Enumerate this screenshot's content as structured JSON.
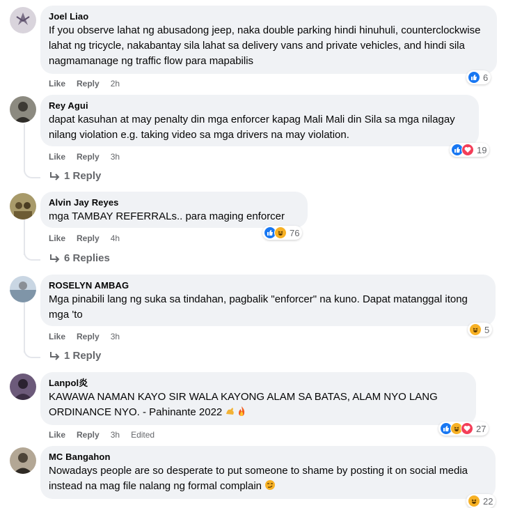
{
  "comments": [
    {
      "author": "Joel Liao",
      "text": "If you observe lahat ng abusadong jeep, naka double parking hindi hinuhuli, counterclockwise lahat ng tricycle, nakabantay sila lahat sa delivery vans and private vehicles, and hindi sila nagmamanage ng traffic flow para mapabilis",
      "like_label": "Like",
      "reply_label": "Reply",
      "time": "2h",
      "reaction_count": "6",
      "reactions": [
        "like"
      ]
    },
    {
      "author": "Rey Agui",
      "text": "dapat kasuhan at may penalty din mga enforcer kapag Mali Mali din Sila sa mga nilagay nilang violation e.g. taking video sa mga drivers na may violation.",
      "like_label": "Like",
      "reply_label": "Reply",
      "time": "3h",
      "reaction_count": "19",
      "reactions": [
        "like",
        "love"
      ],
      "replies_label": "1 Reply"
    },
    {
      "author": "Alvin Jay Reyes",
      "text": "mga TAMBAY REFERRALs.. para maging enforcer",
      "like_label": "Like",
      "reply_label": "Reply",
      "time": "4h",
      "reaction_count": "76",
      "reactions": [
        "like",
        "haha"
      ],
      "replies_label": "6 Replies"
    },
    {
      "author": "ROSELYN AMBAG",
      "text": "Mga pinabili lang ng suka sa tindahan, pagbalik \"enforcer\" na kuno. Dapat matanggal itong mga 'to",
      "like_label": "Like",
      "reply_label": "Reply",
      "time": "3h",
      "reaction_count": "5",
      "reactions": [
        "haha"
      ],
      "replies_label": "1 Reply"
    },
    {
      "author": "Lanpol炎",
      "text": "KAWAWA NAMAN KAYO SIR WALA KAYONG ALAM SA BATAS, ALAM NYO LANG ORDINANCE NYO. - Pahinante 2022",
      "like_label": "Like",
      "reply_label": "Reply",
      "time": "3h",
      "edited_label": "Edited",
      "reaction_count": "27",
      "reactions": [
        "like",
        "haha",
        "love"
      ]
    },
    {
      "author": "MC Bangahon",
      "text": "Nowadays people are so desperate to put someone to shame by posting it on social media instead na mag file nalang ng formal complain",
      "reaction_count": "22",
      "reactions": [
        "haha"
      ]
    }
  ],
  "colors": {
    "bubble": "#f0f2f5",
    "meta": "#65676b",
    "like": "#1877f2",
    "love": "#f33e58",
    "haha": "#f7b125"
  }
}
